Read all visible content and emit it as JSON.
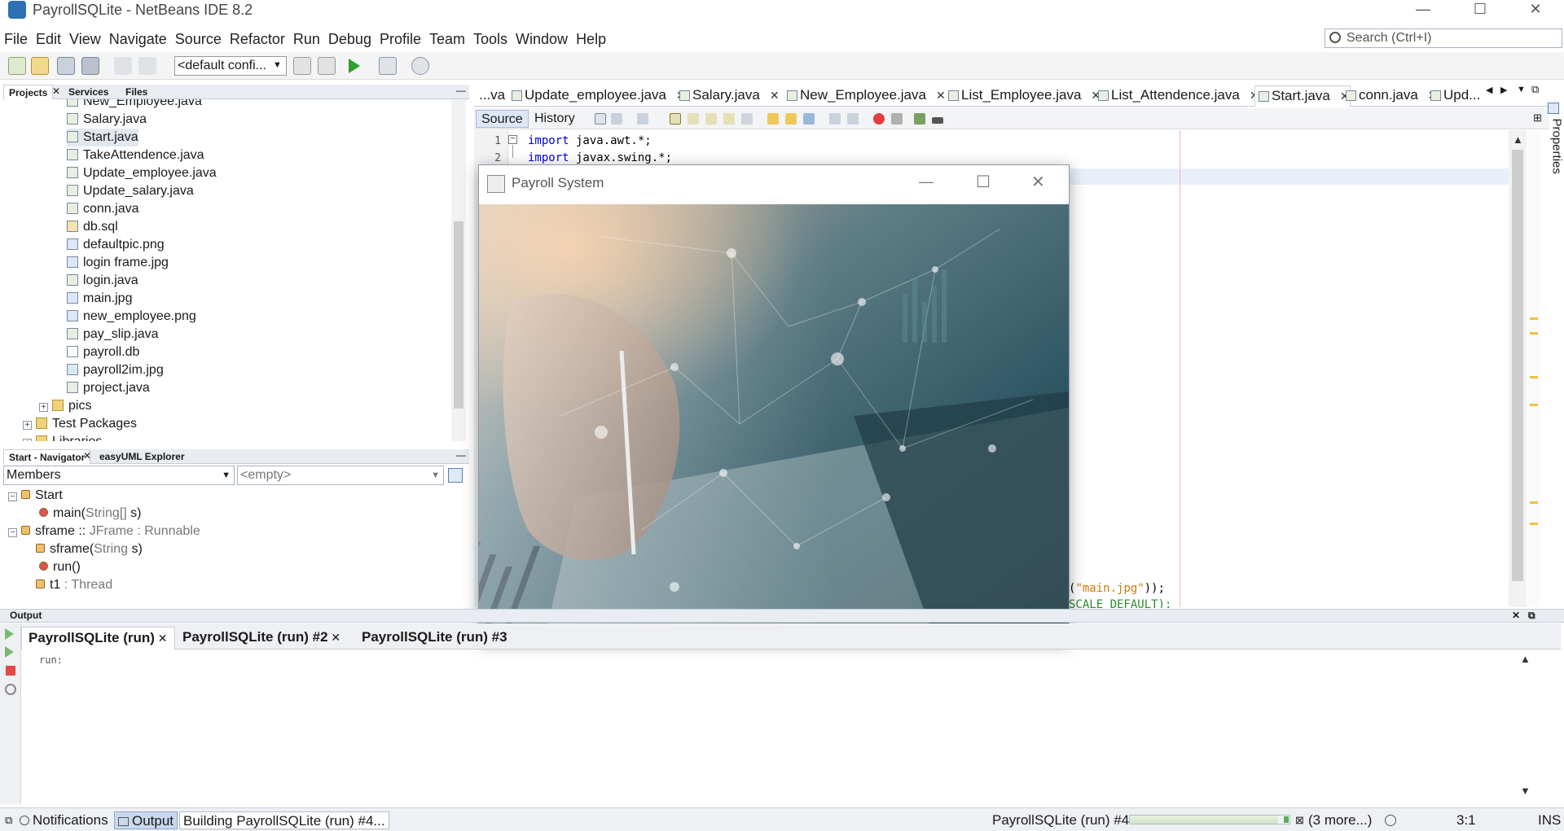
{
  "window": {
    "title": "PayrollSQLite - NetBeans IDE 8.2",
    "minimize": "—",
    "maximize": "☐",
    "close": "✕"
  },
  "menu": [
    "File",
    "Edit",
    "View",
    "Navigate",
    "Source",
    "Refactor",
    "Run",
    "Debug",
    "Profile",
    "Team",
    "Tools",
    "Window",
    "Help"
  ],
  "search": {
    "placeholder": "Search (Ctrl+I)"
  },
  "toolbar": {
    "config": "<default confi..."
  },
  "projects_panel": {
    "tabs": [
      "Projects",
      "Services",
      "Files"
    ],
    "files": [
      {
        "name": "New_Employee.java",
        "type": "java"
      },
      {
        "name": "Salary.java",
        "type": "java"
      },
      {
        "name": "Start.java",
        "type": "java"
      },
      {
        "name": "TakeAttendence.java",
        "type": "java"
      },
      {
        "name": "Update_employee.java",
        "type": "java"
      },
      {
        "name": "Update_salary.java",
        "type": "java"
      },
      {
        "name": "conn.java",
        "type": "java"
      },
      {
        "name": "db.sql",
        "type": "db"
      },
      {
        "name": "defaultpic.png",
        "type": "img"
      },
      {
        "name": "login frame.jpg",
        "type": "img"
      },
      {
        "name": "login.java",
        "type": "java"
      },
      {
        "name": "main.jpg",
        "type": "img"
      },
      {
        "name": "new_employee.png",
        "type": "img"
      },
      {
        "name": "pay_slip.java",
        "type": "java"
      },
      {
        "name": "payroll.db",
        "type": "txt"
      },
      {
        "name": "payroll2im.jpg",
        "type": "img"
      },
      {
        "name": "project.java",
        "type": "java"
      }
    ],
    "pics": "pics",
    "test_packages": "Test Packages",
    "libraries": "Libraries"
  },
  "navigator": {
    "tabs": [
      "Start - Navigator",
      "easyUML Explorer"
    ],
    "members_select": "Members",
    "filter_select": "<empty>",
    "tree": [
      {
        "label": "Start",
        "suffix": ""
      },
      {
        "label": "main(",
        "type_part": "String[]",
        "rest": " s)"
      },
      {
        "label": "sframe :: ",
        "type_part": "JFrame : Runnable",
        "rest": ""
      },
      {
        "label": "sframe(",
        "type_part": "String",
        "rest": " s)"
      },
      {
        "label": "run()",
        "type_part": "",
        "rest": ""
      },
      {
        "label": "t1",
        "type_part": " : Thread",
        "rest": ""
      }
    ]
  },
  "editor": {
    "tabs": [
      "...va",
      "Update_employee.java",
      "Salary.java",
      "New_Employee.java",
      "List_Employee.java",
      "List_Attendence.java",
      "Start.java",
      "conn.java",
      "Upd..."
    ],
    "active_tab": "Start.java",
    "source_label": "Source",
    "history_label": "History",
    "lines": [
      {
        "num": "1",
        "kw": "import",
        "rest": " java.awt.*;"
      },
      {
        "num": "2",
        "kw": "import",
        "rest": " javax.swing.*;"
      }
    ],
    "snippet_string": "\"main.jpg\"",
    "snippet_tail": "));",
    "snippet_prefix": "(",
    "snippet_cut": "SCALE_DEFAULT);"
  },
  "dialog": {
    "title": "Payroll System"
  },
  "properties_label": "Properties",
  "output": {
    "header": "Output",
    "tabs": [
      "PayrollSQLite (run)",
      "PayrollSQLite (run) #2",
      "PayrollSQLite (run) #3"
    ],
    "text": "run:"
  },
  "status": {
    "notifications": "Notifications",
    "output": "Output",
    "building": "Building PayrollSQLite (run) #4...",
    "run_label": "PayrollSQLite (run) #4",
    "more": "(3 more...)",
    "position": "3:1",
    "mode": "INS",
    "progress": 0.93
  }
}
